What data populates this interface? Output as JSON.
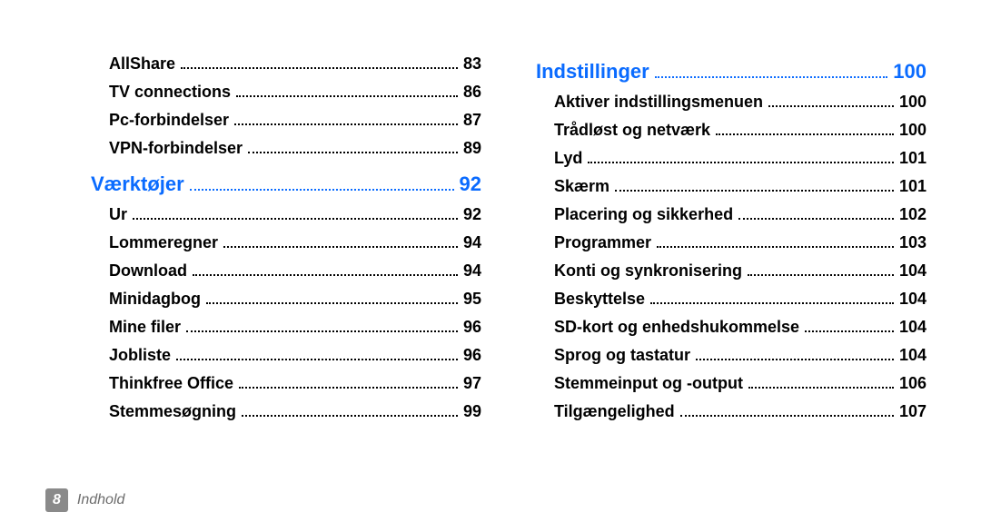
{
  "footer": {
    "page_number": "8",
    "label": "Indhold"
  },
  "columns": [
    {
      "orphan_items": [
        {
          "label": "AllShare",
          "page": "83"
        },
        {
          "label": "TV connections",
          "page": "86"
        },
        {
          "label": "Pc-forbindelser",
          "page": "87"
        },
        {
          "label": "VPN-forbindelser",
          "page": "89"
        }
      ],
      "sections": [
        {
          "title": "Værktøjer",
          "page": "92",
          "items": [
            {
              "label": "Ur",
              "page": "92"
            },
            {
              "label": "Lommeregner",
              "page": "94"
            },
            {
              "label": "Download",
              "page": "94"
            },
            {
              "label": "Minidagbog",
              "page": "95"
            },
            {
              "label": "Mine filer",
              "page": "96"
            },
            {
              "label": "Jobliste",
              "page": "96"
            },
            {
              "label": "Thinkfree Office",
              "page": "97"
            },
            {
              "label": "Stemmesøgning",
              "page": "99"
            }
          ]
        }
      ]
    },
    {
      "orphan_items": [],
      "sections": [
        {
          "title": "Indstillinger",
          "page": "100",
          "items": [
            {
              "label": "Aktiver indstillingsmenuen",
              "page": "100"
            },
            {
              "label": "Trådløst og netværk",
              "page": "100"
            },
            {
              "label": "Lyd",
              "page": "101"
            },
            {
              "label": "Skærm",
              "page": "101"
            },
            {
              "label": "Placering og sikkerhed",
              "page": "102"
            },
            {
              "label": "Programmer",
              "page": "103"
            },
            {
              "label": "Konti og synkronisering",
              "page": "104"
            },
            {
              "label": "Beskyttelse",
              "page": "104"
            },
            {
              "label": "SD-kort og enhedshukommelse",
              "page": "104"
            },
            {
              "label": "Sprog og tastatur",
              "page": "104"
            },
            {
              "label": "Stemmeinput og -output",
              "page": "106"
            },
            {
              "label": "Tilgængelighed",
              "page": "107"
            }
          ]
        }
      ]
    }
  ]
}
